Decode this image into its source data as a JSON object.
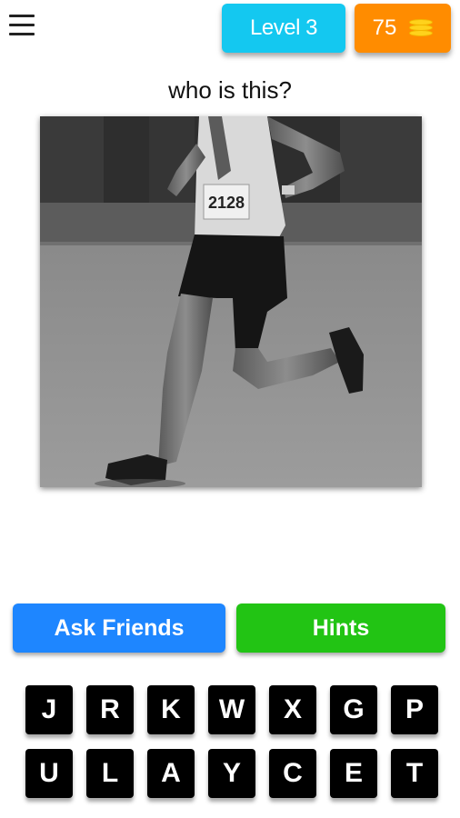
{
  "header": {
    "menu_icon": "hamburger-menu-icon",
    "level_label": "Level 3",
    "coins": "75",
    "coin_icon": "coin-stack-icon",
    "colors": {
      "level": "#14c8f0",
      "coins": "#ff8c00"
    }
  },
  "question": "who is this?",
  "photo": {
    "bib_number": "2128"
  },
  "actions": {
    "ask_friends": "Ask Friends",
    "hints": "Hints",
    "colors": {
      "ask_friends": "#1e86ff",
      "hints": "#22c414"
    }
  },
  "keyboard": {
    "rows": [
      [
        "J",
        "R",
        "K",
        "W",
        "X",
        "G",
        "P"
      ],
      [
        "U",
        "L",
        "A",
        "Y",
        "C",
        "E",
        "T"
      ]
    ]
  }
}
